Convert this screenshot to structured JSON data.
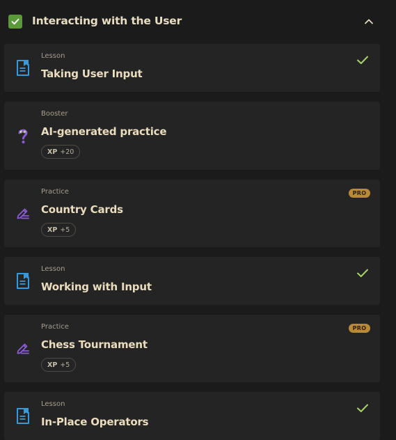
{
  "section": {
    "title": "Interacting with the User",
    "completed": true,
    "expanded": true
  },
  "items": [
    {
      "type": "Lesson",
      "title": "Taking User Input",
      "icon": "lesson-doc-icon",
      "completed": true
    },
    {
      "type": "Booster",
      "title": "AI-generated practice",
      "icon": "ai-question-icon",
      "xp_label": "XP",
      "xp_value": "+20"
    },
    {
      "type": "Practice",
      "title": "Country Cards",
      "icon": "practice-pencil-icon",
      "xp_label": "XP",
      "xp_value": "+5",
      "badge": "PRO"
    },
    {
      "type": "Lesson",
      "title": "Working with Input",
      "icon": "lesson-doc-icon",
      "completed": true
    },
    {
      "type": "Practice",
      "title": "Chess Tournament",
      "icon": "practice-pencil-icon",
      "xp_label": "XP",
      "xp_value": "+5",
      "badge": "PRO"
    },
    {
      "type": "Lesson",
      "title": "In-Place Operators",
      "icon": "lesson-doc-icon",
      "completed": true
    }
  ],
  "colors": {
    "background": "#1b1b1b",
    "card": "#242424",
    "section_check": "#5a9a3a",
    "done_check": "#a8d36a",
    "lesson_icon": "#3a9ad9",
    "practice_icon": "#8b5cd6",
    "pro_badge": "#b88a38",
    "title_text": "#eadcbd"
  }
}
